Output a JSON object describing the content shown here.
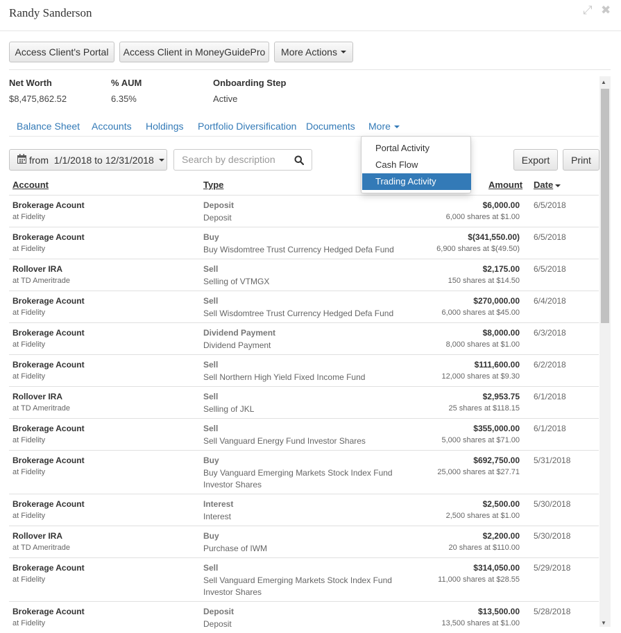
{
  "header": {
    "title": "Randy Sanderson"
  },
  "actions": {
    "portal": "Access Client's Portal",
    "moneyguide": "Access Client in MoneyGuidePro",
    "more": "More Actions"
  },
  "stats": {
    "net_worth_label": "Net Worth",
    "net_worth": "$8,475,862.52",
    "aum_label": "% AUM",
    "aum": "6.35%",
    "step_label": "Onboarding Step",
    "step": "Active"
  },
  "tabs": [
    "Balance Sheet",
    "Accounts",
    "Holdings",
    "Portfolio Diversification",
    "Documents",
    "More"
  ],
  "more_menu": {
    "items": [
      "Portal Activity",
      "Cash Flow",
      "Trading Activity"
    ],
    "selected": "Trading Activity"
  },
  "filters": {
    "date_range": "from  1/1/2018 to 12/31/2018",
    "search_placeholder": "Search by description",
    "export": "Export",
    "print": "Print"
  },
  "columns": {
    "account": "Account",
    "type": "Type",
    "amount": "Amount",
    "date": "Date"
  },
  "colors": {
    "link": "#337ab7",
    "selected_bg": "#337ab7"
  },
  "rows": [
    {
      "account": "Brokerage Acount",
      "institution": "at Fidelity",
      "type": "Deposit",
      "description": "Deposit",
      "amount": "$6,000.00",
      "detail": "6,000 shares at $1.00",
      "date": "6/5/2018"
    },
    {
      "account": "Brokerage Acount",
      "institution": "at Fidelity",
      "type": "Buy",
      "description": "Buy Wisdomtree Trust Currency Hedged Defa Fund",
      "amount": "$(341,550.00)",
      "detail": "6,900 shares at $(49.50)",
      "date": "6/5/2018"
    },
    {
      "account": "Rollover IRA",
      "institution": "at TD Ameritrade",
      "type": "Sell",
      "description": "Selling of VTMGX",
      "amount": "$2,175.00",
      "detail": "150 shares at $14.50",
      "date": "6/5/2018"
    },
    {
      "account": "Brokerage Acount",
      "institution": "at Fidelity",
      "type": "Sell",
      "description": "Sell Wisdomtree Trust Currency Hedged Defa Fund",
      "amount": "$270,000.00",
      "detail": "6,000 shares at $45.00",
      "date": "6/4/2018"
    },
    {
      "account": "Brokerage Acount",
      "institution": "at Fidelity",
      "type": "Dividend Payment",
      "description": "Dividend Payment",
      "amount": "$8,000.00",
      "detail": "8,000 shares at $1.00",
      "date": "6/3/2018"
    },
    {
      "account": "Brokerage Acount",
      "institution": "at Fidelity",
      "type": "Sell",
      "description": "Sell Northern High Yield Fixed Income Fund",
      "amount": "$111,600.00",
      "detail": "12,000 shares at $9.30",
      "date": "6/2/2018"
    },
    {
      "account": "Rollover IRA",
      "institution": "at TD Ameritrade",
      "type": "Sell",
      "description": "Selling of JKL",
      "amount": "$2,953.75",
      "detail": "25 shares at $118.15",
      "date": "6/1/2018"
    },
    {
      "account": "Brokerage Acount",
      "institution": "at Fidelity",
      "type": "Sell",
      "description": "Sell Vanguard Energy Fund Investor Shares",
      "amount": "$355,000.00",
      "detail": "5,000 shares at $71.00",
      "date": "6/1/2018"
    },
    {
      "account": "Brokerage Acount",
      "institution": "at Fidelity",
      "type": "Buy",
      "description": "Buy Vanguard Emerging Markets Stock Index Fund Investor Shares",
      "amount": "$692,750.00",
      "detail": "25,000 shares at $27.71",
      "date": "5/31/2018"
    },
    {
      "account": "Brokerage Acount",
      "institution": "at Fidelity",
      "type": "Interest",
      "description": "Interest",
      "amount": "$2,500.00",
      "detail": "2,500 shares at $1.00",
      "date": "5/30/2018"
    },
    {
      "account": "Rollover IRA",
      "institution": "at TD Ameritrade",
      "type": "Buy",
      "description": "Purchase of IWM",
      "amount": "$2,200.00",
      "detail": "20 shares at $110.00",
      "date": "5/30/2018"
    },
    {
      "account": "Brokerage Acount",
      "institution": "at Fidelity",
      "type": "Sell",
      "description": "Sell Vanguard Emerging Markets Stock Index Fund Investor Shares",
      "amount": "$314,050.00",
      "detail": "11,000 shares at $28.55",
      "date": "5/29/2018"
    },
    {
      "account": "Brokerage Acount",
      "institution": "at Fidelity",
      "type": "Deposit",
      "description": "Deposit",
      "amount": "$13,500.00",
      "detail": "13,500 shares at $1.00",
      "date": "5/28/2018"
    }
  ]
}
